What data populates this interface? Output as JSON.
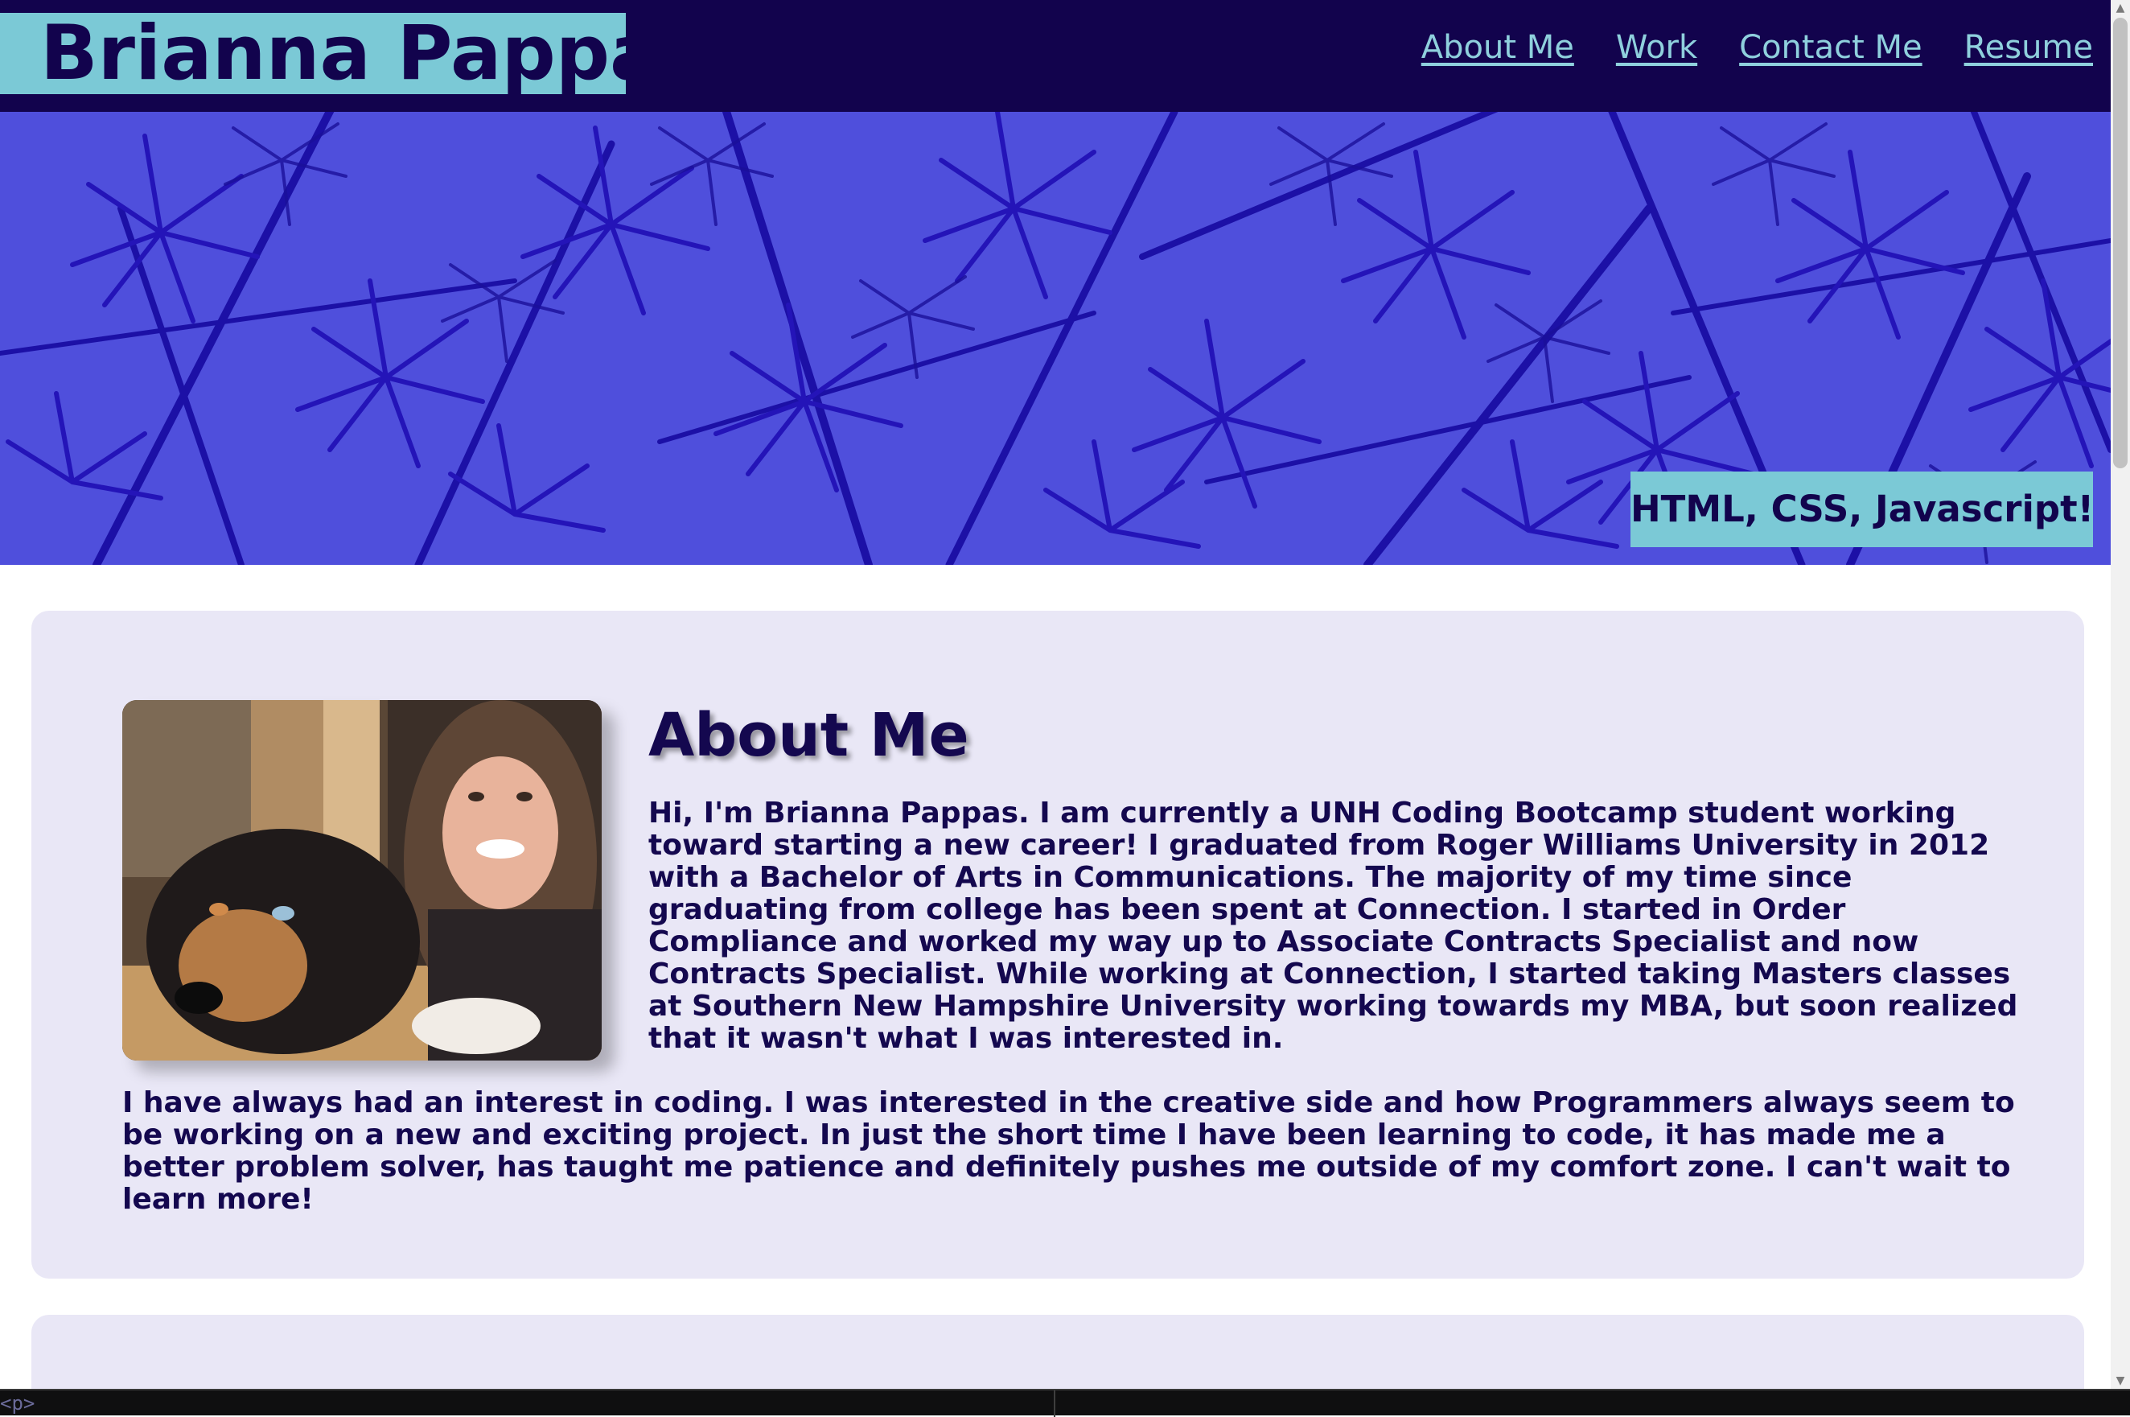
{
  "header": {
    "site_title": "Brianna Pappas",
    "nav": [
      {
        "label": "About Me"
      },
      {
        "label": "Work"
      },
      {
        "label": "Contact Me"
      },
      {
        "label": "Resume"
      }
    ]
  },
  "hero": {
    "tagline": "HTML, CSS, Javascript!"
  },
  "about": {
    "heading": "About Me",
    "paragraphs": [
      "Hi, I'm Brianna Pappas. I am currently a UNH Coding Bootcamp student working toward starting a new career! I graduated from Roger Williams University in 2012 with a Bachelor of Arts in Communications. The majority of my time since graduating from college has been spent at Connection. I started in Order Compliance and worked my way up to Associate Contracts Specialist and now Contracts Specialist. While working at Connection, I started taking Masters classes at Southern New Hampshire University working towards my MBA, but soon realized that it wasn't what I was interested in.",
      "I have always had an interest in coding. I was interested in the creative side and how Programmers always seem to be working on a new and exciting project. In just the short time I have been learning to code, it has made me a better problem solver, has taught me patience and definitely pushes me outside of my comfort zone. I can't wait to learn more!"
    ]
  },
  "devtools": {
    "element_tag": "<p>"
  },
  "colors": {
    "header_bg": "#12034d",
    "accent": "#7bc9d6",
    "hero_bg": "#4b4bd8",
    "card_bg": "#e9e7f6",
    "text_dark": "#14084f"
  }
}
